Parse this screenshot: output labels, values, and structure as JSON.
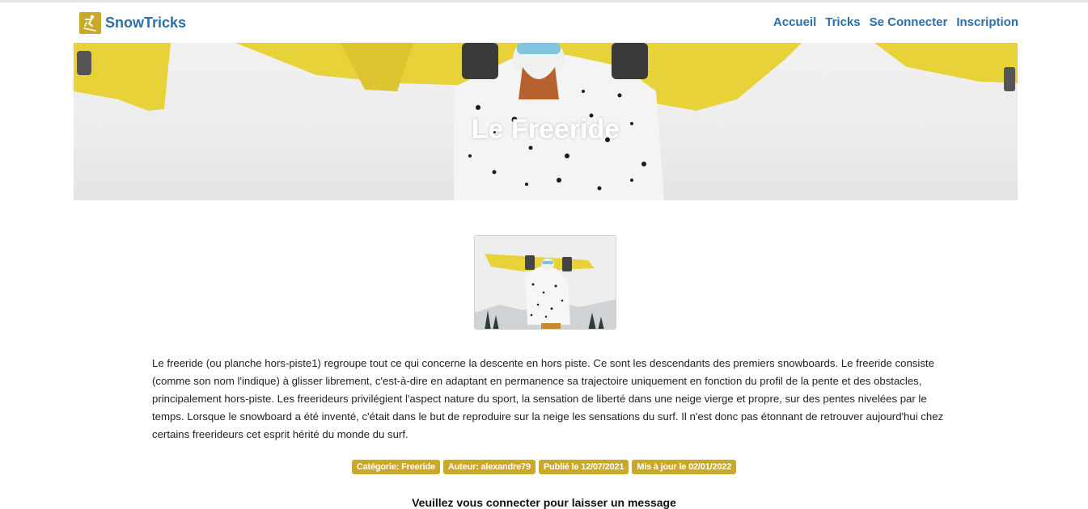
{
  "brand": {
    "name": "SnowTricks",
    "logo_icon": "ski-logo-icon"
  },
  "nav": {
    "items": [
      "Accueil",
      "Tricks",
      "Se Connecter",
      "Inscription"
    ]
  },
  "colors": {
    "accent": "#caa82a",
    "link": "#2c6fa8"
  },
  "hero": {
    "title": "Le Freeride"
  },
  "trick": {
    "description": "Le freeride (ou planche hors-piste1) regroupe tout ce qui concerne la descente en hors piste. Ce sont les descendants des premiers snowboards. Le freeride consiste (comme son nom l'indique) à glisser librement, c'est-à-dire en adaptant en permanence sa trajectoire uniquement en fonction du profil de la pente et des obstacles, principalement hors-piste. Les freerideurs privilégient l'aspect nature du sport, la sensation de liberté dans une neige vierge et propre, sur des pentes nivelées par le temps. Lorsque le snowboard a été inventé, c'était dans le but de reproduire sur la neige les sensations du surf. Il n'est donc pas étonnant de retrouver aujourd'hui chez certains freerideurs cet esprit hérité du monde du surf.",
    "badges": {
      "category": "Catégorie: Freeride",
      "author": "Auteur: alexandre79",
      "published": "Publié le 12/07/2021",
      "updated": "Mis à jour le 02/01/2022"
    }
  },
  "comments": {
    "login_prompt": "Veuillez vous connecter pour laisser un message"
  }
}
